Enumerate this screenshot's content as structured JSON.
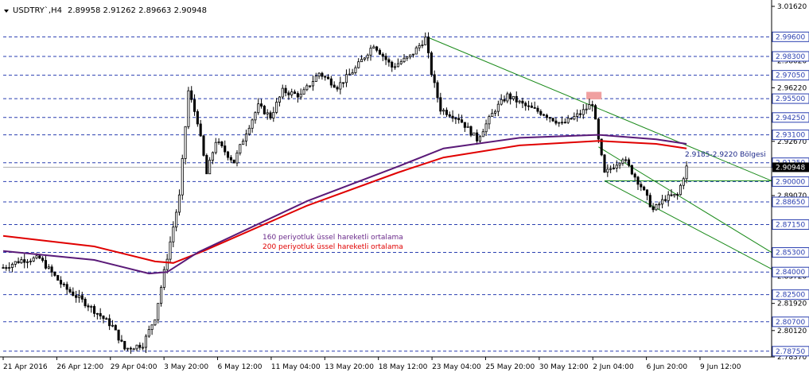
{
  "header": {
    "symbol": "USDTRY`,H4",
    "ohlc": "2.89958 2.91262 2.89663 2.90948"
  },
  "colors": {
    "background": "#ffffff",
    "candle": "#000000",
    "ema160": "#5a1a78",
    "ema200": "#e00000",
    "dashed_level": "#2a3fb0",
    "trendline": "#1a8a1a",
    "current_price_line": "#b0b0b0",
    "price_box": "#000000",
    "level_box": "#ffffff",
    "highlight": "#f0a0a0"
  },
  "chart_data": {
    "type": "candlestick",
    "timeframe": "H4",
    "ylim": [
      2.7837,
      3.0162
    ],
    "y_ticks": [
      "3.01620",
      "2.99600",
      "2.98020",
      "2.96220",
      "2.94250",
      "2.92670",
      "2.91250",
      "2.90948",
      "2.89070",
      "2.87150",
      "2.85300",
      "2.83720",
      "2.81920",
      "2.80120",
      "2.78370"
    ],
    "level_lines": [
      2.996,
      2.983,
      2.9705,
      2.955,
      2.9425,
      2.931,
      2.9125,
      2.9,
      2.8865,
      2.8715,
      2.853,
      2.84,
      2.825,
      2.807,
      2.7875
    ],
    "level_labels": [
      "2.99600",
      "2.98300",
      "2.97050",
      "2.95500",
      "2.94250",
      "2.93100",
      "2.91250",
      "2.90000",
      "2.88650",
      "2.87150",
      "2.85300",
      "2.84000",
      "2.82500",
      "2.80700",
      "2.78750"
    ],
    "current_price": 2.90948,
    "current_price_label": "2.90948",
    "x_labels": [
      "21 Apr 2016",
      "26 Apr 12:00",
      "29 Apr 04:00",
      "3 May 20:00",
      "6 May 12:00",
      "11 May 04:00",
      "13 May 20:00",
      "18 May 12:00",
      "23 May 04:00",
      "25 May 20:00",
      "30 May 12:00",
      "2 Jun 04:00",
      "6 Jun 20:00",
      "9 Jun 12:00"
    ],
    "anchors": [
      [
        0,
        2.843
      ],
      [
        6,
        2.848
      ],
      [
        12,
        2.849
      ],
      [
        20,
        2.83
      ],
      [
        28,
        2.818
      ],
      [
        36,
        2.804
      ],
      [
        40,
        2.789
      ],
      [
        46,
        2.792
      ],
      [
        50,
        2.81
      ],
      [
        54,
        2.85
      ],
      [
        58,
        2.89
      ],
      [
        61,
        2.96
      ],
      [
        64,
        2.94
      ],
      [
        67,
        2.905
      ],
      [
        70,
        2.927
      ],
      [
        76,
        2.913
      ],
      [
        80,
        2.933
      ],
      [
        84,
        2.95
      ],
      [
        88,
        2.943
      ],
      [
        92,
        2.96
      ],
      [
        98,
        2.957
      ],
      [
        104,
        2.972
      ],
      [
        110,
        2.963
      ],
      [
        116,
        2.975
      ],
      [
        122,
        2.991
      ],
      [
        128,
        2.976
      ],
      [
        134,
        2.983
      ],
      [
        139,
        2.995
      ],
      [
        141,
        2.972
      ],
      [
        144,
        2.948
      ],
      [
        150,
        2.942
      ],
      [
        156,
        2.928
      ],
      [
        162,
        2.948
      ],
      [
        166,
        2.957
      ],
      [
        172,
        2.95
      ],
      [
        178,
        2.945
      ],
      [
        184,
        2.938
      ],
      [
        190,
        2.945
      ],
      [
        194,
        2.952
      ],
      [
        196,
        2.927
      ],
      [
        198,
        2.905
      ],
      [
        204,
        2.916
      ],
      [
        210,
        2.897
      ],
      [
        214,
        2.881
      ],
      [
        218,
        2.889
      ],
      [
        222,
        2.891
      ],
      [
        225,
        2.9095
      ]
    ],
    "ema160": [
      [
        0,
        2.854
      ],
      [
        30,
        2.848
      ],
      [
        48,
        2.839
      ],
      [
        54,
        2.84
      ],
      [
        64,
        2.853
      ],
      [
        100,
        2.887
      ],
      [
        130,
        2.91
      ],
      [
        145,
        2.922
      ],
      [
        170,
        2.929
      ],
      [
        196,
        2.931
      ],
      [
        215,
        2.928
      ],
      [
        225,
        2.925
      ]
    ],
    "ema200": [
      [
        0,
        2.864
      ],
      [
        30,
        2.857
      ],
      [
        50,
        2.847
      ],
      [
        56,
        2.846
      ],
      [
        66,
        2.854
      ],
      [
        100,
        2.884
      ],
      [
        130,
        2.906
      ],
      [
        145,
        2.916
      ],
      [
        170,
        2.924
      ],
      [
        196,
        2.927
      ],
      [
        215,
        2.925
      ],
      [
        225,
        2.922
      ]
    ],
    "trendlines": [
      {
        "from": [
          140,
          2.9955
        ],
        "to": [
          253,
          2.9005
        ]
      },
      {
        "from": [
          196,
          2.923
        ],
        "to": [
          253,
          2.853
        ]
      },
      {
        "from": [
          198,
          2.9005
        ],
        "to": [
          253,
          2.842
        ]
      },
      {
        "from": [
          198,
          2.9005
        ],
        "to": [
          253,
          2.9005
        ]
      }
    ],
    "highlight_zone": {
      "x_from": 192,
      "x_to": 197,
      "y_from": 2.9545,
      "y_to": 2.9595
    },
    "annotations": {
      "ema160_label": "160 periyotluk üssel hareketli ortalama",
      "ema200_label": "200 periyotluk üssel hareketli ortalama",
      "zone_label": "2.9185-2.9220 Bölgesi"
    }
  }
}
